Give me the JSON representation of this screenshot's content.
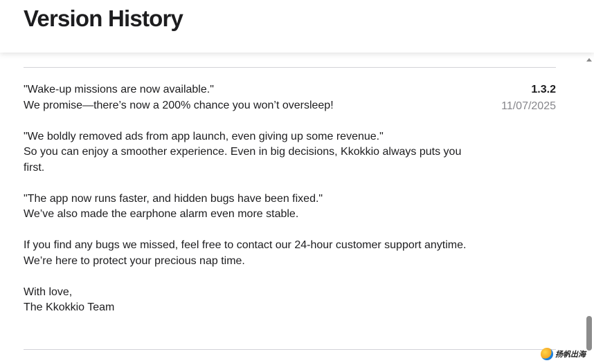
{
  "header": {
    "title": "Version History"
  },
  "release": {
    "version": "1.3.2",
    "date": "11/07/2025",
    "notes": [
      [
        "\"Wake-up missions are now available.\"",
        "We promise—there’s now a 200% chance you won’t oversleep!"
      ],
      [
        "\"We boldly removed ads from app launch, even giving up some revenue.\"",
        "So you can enjoy a smoother experience. Even in big decisions, Kkokkio always puts you first."
      ],
      [
        "\"The app now runs faster, and hidden bugs have been fixed.\"",
        "We’ve also made the earphone alarm even more stable."
      ],
      [
        "If you find any bugs we missed, feel free to contact our 24-hour customer support anytime.",
        "We’re here to protect your precious nap time."
      ],
      [
        "With love,",
        "The Kkokkio Team"
      ]
    ]
  },
  "watermark": {
    "text": "扬帆出海"
  }
}
